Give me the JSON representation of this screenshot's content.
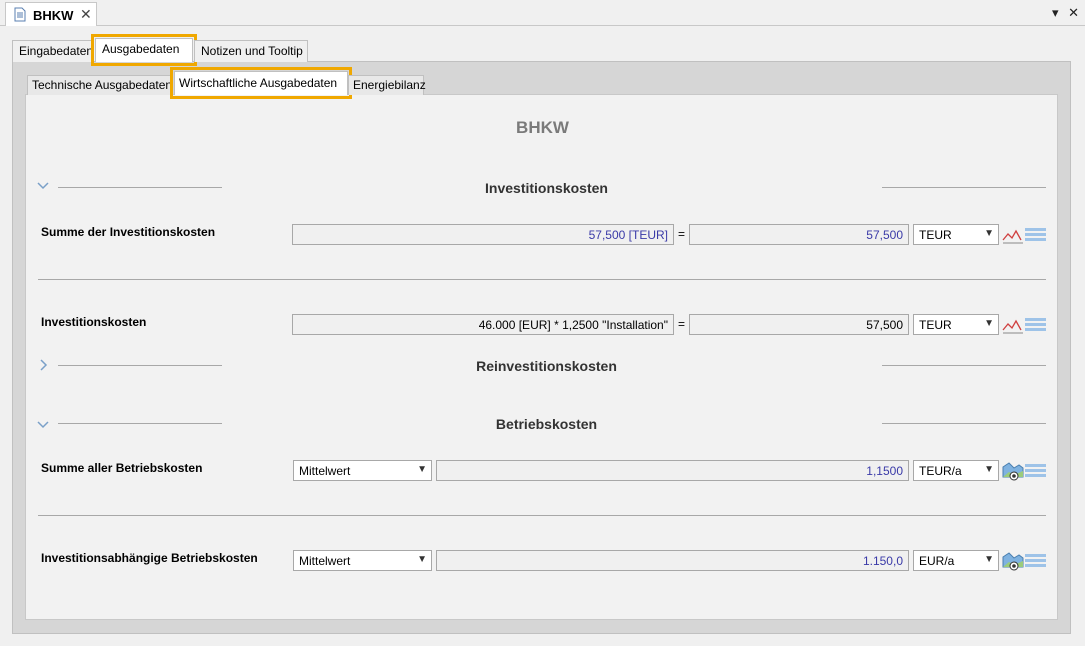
{
  "editor": {
    "tab_title": "BHKW",
    "close_glyph": "✕",
    "dropdown_glyph": "▾",
    "window_close_glyph": "✕"
  },
  "outer_tabs": [
    {
      "label": "Eingabedaten"
    },
    {
      "label": "Ausgabedaten"
    },
    {
      "label": "Notizen und Tooltip"
    }
  ],
  "inner_tabs": [
    {
      "label": "Technische Ausgabedaten"
    },
    {
      "label": "Wirtschaftliche Ausgabedaten"
    },
    {
      "label": "Energiebilanz"
    }
  ],
  "page_title": "BHKW",
  "sections": {
    "invest": {
      "title": "Investitionskosten",
      "expanded": true
    },
    "reinvest": {
      "title": "Reinvestitionskosten",
      "expanded": false
    },
    "betrieb": {
      "title": "Betriebskosten",
      "expanded": true
    }
  },
  "rows": {
    "summe_invest": {
      "label": "Summe der Investitionskosten",
      "formula": "57,500 [TEUR]",
      "eq": "=",
      "value": "57,500",
      "unit": "TEUR"
    },
    "invest": {
      "label": "Investitionskosten",
      "formula": "46.000 [EUR] * 1,2500 \"Installation\"",
      "eq": "=",
      "value": "57,500",
      "unit": "TEUR"
    },
    "summe_betrieb": {
      "label": "Summe aller Betriebskosten",
      "mode": "Mittelwert",
      "value": "1,1500",
      "unit": "TEUR/a"
    },
    "invest_betrieb": {
      "label": "Investitionsabhängige Betriebskosten",
      "mode": "Mittelwert",
      "value": "1.150,0",
      "unit": "EUR/a"
    }
  },
  "colors": {
    "highlight": "#f0a800",
    "blue_value": "#3a3aa8"
  },
  "icons": [
    "document-icon",
    "chart-icon",
    "list-icon",
    "map-view-icon",
    "chevron-down-icon",
    "chevron-right-icon"
  ]
}
